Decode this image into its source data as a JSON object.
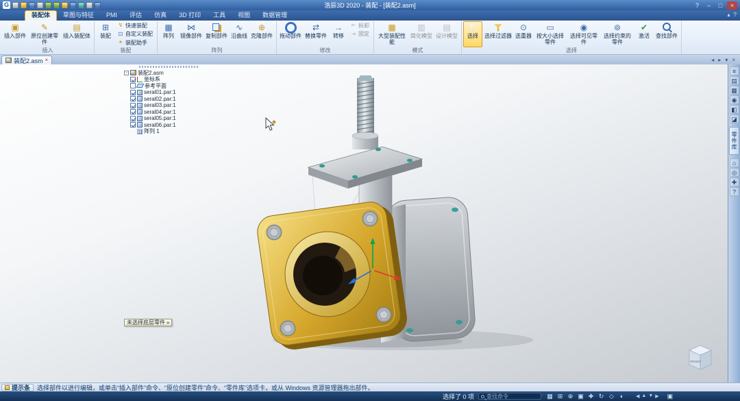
{
  "window": {
    "title": "浩辰3D 2020 - 装配 - [装配2.asm]"
  },
  "colors": {
    "titlebar_blue": "#2f5e9e",
    "accent_gold": "#d9a62e",
    "highlight": "#ffd75e",
    "teal_hole": "#2f9a94",
    "viewport_top": "#ffffff",
    "viewport_bottom": "#c6cbd1"
  },
  "titlebar": {
    "logo_glyph": "G",
    "qat": [
      {
        "name": "new-document-icon",
        "cls": "c-gray"
      },
      {
        "name": "open-icon",
        "cls": "c-gold"
      },
      {
        "name": "save-icon",
        "cls": "c-blue"
      },
      {
        "name": "print-icon",
        "cls": "c-gray"
      },
      {
        "name": "undo-icon",
        "cls": "c-green"
      },
      {
        "name": "redo-icon",
        "cls": "c-green"
      },
      {
        "name": "select-tool-icon",
        "cls": "c-gold"
      },
      {
        "name": "zoom-fit-icon",
        "cls": "c-blue"
      },
      {
        "name": "shaded-view-icon",
        "cls": "c-teal"
      },
      {
        "name": "settings-icon",
        "cls": "c-gray"
      },
      {
        "name": "customize-toolbar-icon",
        "cls": "c-blue"
      }
    ],
    "window_buttons": [
      {
        "name": "help-button",
        "glyph": "?",
        "cls": ""
      },
      {
        "name": "minimize-button",
        "glyph": "–",
        "cls": ""
      },
      {
        "name": "restore-button",
        "glyph": "□",
        "cls": ""
      },
      {
        "name": "close-button",
        "glyph": "×",
        "cls": "wb-close"
      }
    ]
  },
  "ribbon": {
    "tabs": [
      {
        "name": "tab-assembly",
        "label": "装配体",
        "cls": "active"
      },
      {
        "name": "tab-sketch-features",
        "label": "草图与特征",
        "cls": ""
      },
      {
        "name": "tab-pmi",
        "label": "PMI",
        "cls": ""
      },
      {
        "name": "tab-evaluate",
        "label": "评估",
        "cls": ""
      },
      {
        "name": "tab-simulation",
        "label": "仿真",
        "cls": ""
      },
      {
        "name": "tab-3d-print",
        "label": "3D 打印",
        "cls": ""
      },
      {
        "name": "tab-tools",
        "label": "工具",
        "cls": ""
      },
      {
        "name": "tab-view",
        "label": "视图",
        "cls": ""
      },
      {
        "name": "tab-data-management",
        "label": "数据管理",
        "cls": ""
      }
    ],
    "tab_right_icons": [
      {
        "name": "minimize-ribbon-icon",
        "glyph": "▴"
      },
      {
        "name": "ribbon-help-icon",
        "glyph": "?"
      }
    ],
    "groups": [
      {
        "label": "插入",
        "buttons": [
          {
            "name": "insert-part-button",
            "icon": "insert-part-icon",
            "label": "插入部件",
            "glyph": "▣",
            "cls": "rb-big",
            "icls": "g-gold"
          },
          {
            "name": "create-in-place-button",
            "icon": "create-in-place-icon",
            "label": "原位创建零件",
            "glyph": "✎",
            "cls": "rb-big",
            "icls": "g-gold"
          },
          {
            "name": "insert-assembly-button",
            "icon": "insert-assembly-icon",
            "label": "插入装配体",
            "glyph": "▤",
            "cls": "rb-big",
            "icls": "g-gold"
          }
        ]
      },
      {
        "label": "装配",
        "buttons": [
          {
            "name": "assemble-button",
            "icon": "assemble-icon",
            "label": "装配",
            "glyph": "⊞",
            "cls": "rb-big",
            "icls": "g-blue"
          },
          {
            "name": "flashfit-button",
            "icon": "flashfit-icon",
            "label": "快速装配",
            "glyph": "↯",
            "cls": "rb-small",
            "icls": "g-gold"
          },
          {
            "name": "custom-assemble-button",
            "icon": "custom-assemble-icon",
            "label": "自定义装配",
            "glyph": "⊡",
            "cls": "rb-small",
            "icls": "g-blue"
          },
          {
            "name": "assembly-assistant-button",
            "icon": "assembly-assistant-icon",
            "label": "装配助手",
            "glyph": "✶",
            "cls": "rb-small",
            "icls": "g-gold"
          }
        ]
      },
      {
        "label": "阵列",
        "buttons": [
          {
            "name": "pattern-button",
            "icon": "pattern-icon",
            "label": "阵列",
            "glyph": "▦",
            "cls": "rb-big",
            "icls": "g-blue"
          },
          {
            "name": "mirror-components-button",
            "icon": "mirror-components-icon",
            "label": "镜像部件",
            "glyph": "⋈",
            "cls": "rb-big",
            "icls": "g-blue"
          },
          {
            "name": "duplicate-components-button",
            "icon": "duplicate-components-icon",
            "label": "复制部件",
            "glyph": "",
            "cls": "rb-big",
            "icls": "ib-copy"
          },
          {
            "name": "along-curve-button",
            "icon": "along-curve-icon",
            "label": "沿曲线",
            "glyph": "∿",
            "cls": "rb-big",
            "icls": "g-blue"
          },
          {
            "name": "clone-components-button",
            "icon": "clone-components-icon",
            "label": "克隆部件",
            "glyph": "⊕",
            "cls": "rb-big",
            "icls": "g-gold"
          }
        ]
      },
      {
        "label": "修改",
        "buttons": [
          {
            "name": "drag-component-button",
            "icon": "drag-component-icon",
            "label": "拖动部件",
            "glyph": "",
            "cls": "rb-big",
            "icls": "ib-ring"
          },
          {
            "name": "replace-part-button",
            "icon": "replace-part-icon",
            "label": "替换零件",
            "glyph": "⇄",
            "cls": "rb-big",
            "icls": "g-blue"
          },
          {
            "name": "transfer-button",
            "icon": "transfer-icon",
            "label": "转移",
            "glyph": "→",
            "cls": "rb-big",
            "icls": "g-blue"
          },
          {
            "name": "detach-button",
            "icon": "detach-icon",
            "label": "拆卸",
            "glyph": "⇤",
            "cls": "rb-small disabled",
            "icls": "g-gray"
          },
          {
            "name": "fix-button",
            "icon": "fix-icon",
            "label": "固定",
            "glyph": "⇥",
            "cls": "rb-small disabled",
            "icls": "g-gray"
          }
        ]
      },
      {
        "label": "模式",
        "buttons": [
          {
            "name": "large-assembly-button",
            "icon": "large-assembly-icon",
            "label": "大型装配性能",
            "glyph": "▦",
            "cls": "rb-big",
            "icls": "g-gold"
          },
          {
            "name": "simplified-model-button",
            "icon": "simplified-model-icon",
            "label": "简化模型",
            "glyph": "▥",
            "cls": "rb-big disabled",
            "icls": "g-gray"
          },
          {
            "name": "design-model-button",
            "icon": "design-model-icon",
            "label": "设计模型",
            "glyph": "▤",
            "cls": "rb-big disabled",
            "icls": "g-gray"
          }
        ]
      },
      {
        "label": "选择",
        "buttons": [
          {
            "name": "select-button",
            "icon": "select-pointer-icon",
            "label": "选择",
            "glyph": "",
            "cls": "rb-big sel",
            "icls": "ib-pointer"
          },
          {
            "name": "select-filter-button",
            "icon": "select-filter-icon",
            "label": "选择过滤器",
            "glyph": "",
            "cls": "rb-big",
            "icls": "ib-funnel"
          },
          {
            "name": "select-set-button",
            "icon": "select-set-icon",
            "label": "选重器",
            "glyph": "⊙",
            "cls": "rb-big",
            "icls": "g-blue"
          },
          {
            "name": "select-by-size-button",
            "icon": "select-by-size-icon",
            "label": "按大小选择零件",
            "glyph": "▭",
            "cls": "rb-big",
            "icls": "g-blue"
          },
          {
            "name": "select-visible-button",
            "icon": "select-visible-icon",
            "label": "选择可见零件",
            "glyph": "◉",
            "cls": "rb-big",
            "icls": "g-blue"
          },
          {
            "name": "select-constrained-button",
            "icon": "select-constrained-icon",
            "label": "选择约束的零件",
            "glyph": "⊚",
            "cls": "rb-big",
            "icls": "g-blue"
          },
          {
            "name": "activate-button",
            "icon": "activate-icon",
            "label": "激活",
            "glyph": "✔",
            "cls": "rb-big",
            "icls": "g-green"
          },
          {
            "name": "find-component-button",
            "icon": "find-component-icon",
            "label": "查找部件",
            "glyph": "",
            "cls": "rb-big",
            "icls": "ib-mag"
          }
        ]
      }
    ]
  },
  "document_tabs": [
    {
      "label": "装配2.asm",
      "close_glyph": "×"
    }
  ],
  "docbar_right_icons": [
    {
      "name": "scroll-tabs-left-icon",
      "glyph": "◂"
    },
    {
      "name": "scroll-tabs-right-icon",
      "glyph": "▸"
    },
    {
      "name": "window-list-icon",
      "glyph": "▾"
    },
    {
      "name": "close-document-icon",
      "glyph": "×"
    }
  ],
  "pathfinder": {
    "root_label": "装配2.asm",
    "expander_glyph": "-",
    "items": [
      {
        "label": "坐标系",
        "cbcls": "on",
        "icls": "t-csys",
        "icon": "coordinate-system-icon"
      },
      {
        "label": "参考平面",
        "cbcls": "off",
        "icls": "t-plane",
        "icon": "reference-planes-icon"
      },
      {
        "label": "seral01.par:1",
        "cbcls": "on",
        "icls": "t-part",
        "icon": "part-icon"
      },
      {
        "label": "seral02.par:1",
        "cbcls": "on",
        "icls": "t-part",
        "icon": "part-icon"
      },
      {
        "label": "seral03.par:1",
        "cbcls": "on",
        "icls": "t-part",
        "icon": "part-icon"
      },
      {
        "label": "seral04.par:1",
        "cbcls": "on",
        "icls": "t-part",
        "icon": "part-icon"
      },
      {
        "label": "seral05.par:1",
        "cbcls": "on",
        "icls": "t-part",
        "icon": "part-icon"
      },
      {
        "label": "seral06.par:1",
        "cbcls": "on",
        "icls": "t-part",
        "icon": "part-icon"
      },
      {
        "label": "阵列 1",
        "cbcls": "none",
        "icls": "t-pattern",
        "icon": "pattern-node-icon"
      }
    ]
  },
  "viewport": {
    "hint_label": "未选择底层零件",
    "hint_arrow": "»",
    "viewcube_label": "FRONT"
  },
  "rightbar": {
    "top_icons": [
      {
        "name": "pathfinder-icon",
        "glyph": "≡"
      },
      {
        "name": "library-icon",
        "glyph": "▤"
      },
      {
        "name": "layers-icon",
        "glyph": "▦"
      },
      {
        "name": "sensors-icon",
        "glyph": "◉"
      },
      {
        "name": "simplify-icon",
        "glyph": "◧"
      },
      {
        "name": "section-icon",
        "glyph": "◪"
      }
    ],
    "tab_label": "零件库",
    "bottom_icons": [
      {
        "name": "home-view-icon",
        "glyph": "⌂"
      },
      {
        "name": "camera-icon",
        "glyph": "◎"
      },
      {
        "name": "pan-tool-icon",
        "glyph": "✚"
      },
      {
        "name": "panel-help-icon",
        "glyph": "?"
      }
    ]
  },
  "statusbar": {
    "label": "提示条",
    "prompt": "选择部件以进行编辑，或单击“插入部件”命令、“原位创建零件”命令、“零件库”选项卡，或从 Windows 资源管理器拖出部件。"
  },
  "taskbar": {
    "selection": "选择了 0 项",
    "search_placeholder": "查找命令",
    "icons": [
      {
        "name": "status-grid-icon",
        "glyph": "▦"
      },
      {
        "name": "zoom-window-icon",
        "glyph": "⊞"
      },
      {
        "name": "zoom-icon",
        "glyph": "⊕"
      },
      {
        "name": "fit-view-icon",
        "glyph": "▣"
      },
      {
        "name": "pan-icon",
        "glyph": "✚"
      },
      {
        "name": "rotate-view-icon",
        "glyph": "↻"
      },
      {
        "name": "common-views-icon",
        "glyph": "◇"
      },
      {
        "name": "view-styles-icon",
        "glyph": "◐"
      }
    ],
    "nav_arrows": [
      {
        "name": "pan-left-icon",
        "glyph": "◀"
      },
      {
        "name": "pan-up-icon",
        "glyph": "▲"
      },
      {
        "name": "pan-down-icon",
        "glyph": "▼"
      },
      {
        "name": "pan-right-icon",
        "glyph": "▶"
      }
    ],
    "right_icon": {
      "name": "display-toggle-icon",
      "glyph": "▣"
    }
  }
}
